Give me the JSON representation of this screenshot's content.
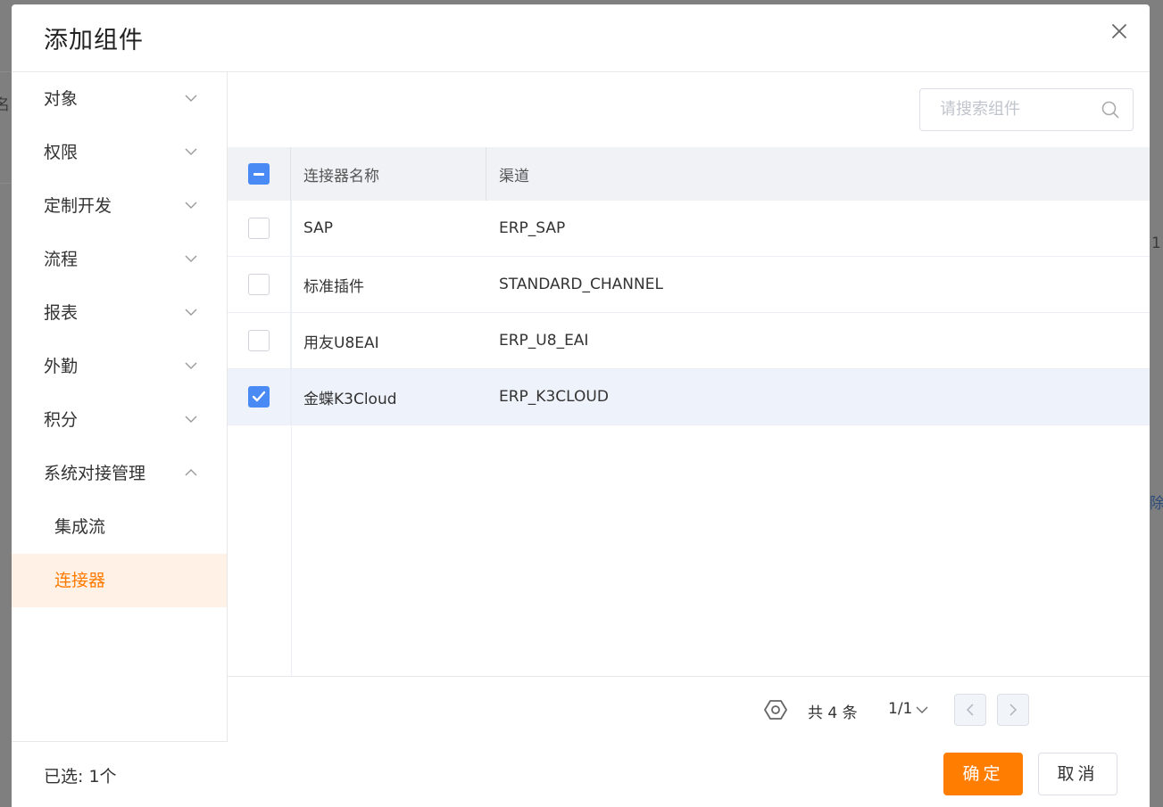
{
  "background": {
    "left_text": "名",
    "right_text_1": "1",
    "right_text_2": "除"
  },
  "modal": {
    "title": "添加组件",
    "close_icon": "close-icon"
  },
  "sidebar": {
    "items": [
      {
        "label": "对象",
        "icon": "chevron-down-icon"
      },
      {
        "label": "权限",
        "icon": "chevron-down-icon"
      },
      {
        "label": "定制开发",
        "icon": "chevron-down-icon"
      },
      {
        "label": "流程",
        "icon": "chevron-down-icon"
      },
      {
        "label": "报表",
        "icon": "chevron-down-icon"
      },
      {
        "label": "外勤",
        "icon": "chevron-down-icon"
      },
      {
        "label": "积分",
        "icon": "chevron-down-icon"
      },
      {
        "label": "系统对接管理",
        "icon": "chevron-up-icon",
        "expanded": true
      }
    ],
    "sub_items": [
      {
        "label": "集成流",
        "active": false
      },
      {
        "label": "连接器",
        "active": true
      }
    ]
  },
  "search": {
    "placeholder": "请搜索组件",
    "value": ""
  },
  "table": {
    "columns": [
      "连接器名称",
      "渠道"
    ],
    "header_checkbox": "indeterminate",
    "rows": [
      {
        "name": "SAP",
        "channel": "ERP_SAP",
        "checked": false
      },
      {
        "name": "标准插件",
        "channel": "STANDARD_CHANNEL",
        "checked": false
      },
      {
        "name": "用友U8EAI",
        "channel": "ERP_U8_EAI",
        "checked": false
      },
      {
        "name": "金蝶K3Cloud",
        "channel": "ERP_K3CLOUD",
        "checked": true
      }
    ]
  },
  "pagination": {
    "total": "共 4 条",
    "page": "1/1"
  },
  "footer": {
    "selected": "已选: 1个",
    "ok_label": "确定",
    "cancel_label": "取消"
  },
  "colors": {
    "accent": "#ff7d00",
    "active_text": "#ff7b00",
    "active_bg": "#fff1e6",
    "checkbox_blue": "#4a8af4",
    "selected_row_bg": "#eef3fb",
    "overlay": "#7f7f7f"
  }
}
